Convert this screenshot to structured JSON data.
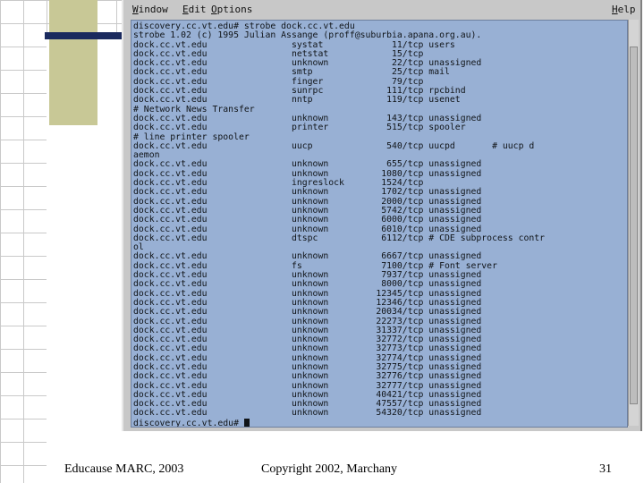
{
  "window": {
    "menu": [
      {
        "label": "Window",
        "underline": "W",
        "rest": "indow"
      },
      {
        "label": "Edit",
        "underline": "E",
        "rest": "dit"
      },
      {
        "label": "Options",
        "underline": "O",
        "rest": "ptions"
      },
      {
        "label": "Help",
        "underline": "H",
        "rest": "elp"
      }
    ]
  },
  "terminal": {
    "lines": [
      "discovery.cc.vt.edu# strobe dock.cc.vt.edu",
      "strobe 1.02 (c) 1995 Julian Assange (proff@suburbia.apana.org.au).",
      "dock.cc.vt.edu                systat             11/tcp users",
      "dock.cc.vt.edu                netstat            15/tcp",
      "dock.cc.vt.edu                unknown            22/tcp unassigned",
      "dock.cc.vt.edu                smtp               25/tcp mail",
      "dock.cc.vt.edu                finger             79/tcp",
      "dock.cc.vt.edu                sunrpc            111/tcp rpcbind",
      "dock.cc.vt.edu                nntp              119/tcp usenet",
      "# Network News Transfer",
      "dock.cc.vt.edu                unknown           143/tcp unassigned",
      "dock.cc.vt.edu                printer           515/tcp spooler",
      "# line printer spooler",
      "dock.cc.vt.edu                uucp              540/tcp uucpd       # uucp d",
      "aemon",
      "dock.cc.vt.edu                unknown           655/tcp unassigned",
      "dock.cc.vt.edu                unknown          1080/tcp unassigned",
      "dock.cc.vt.edu                ingreslock       1524/tcp",
      "dock.cc.vt.edu                unknown          1702/tcp unassigned",
      "dock.cc.vt.edu                unknown          2000/tcp unassigned",
      "dock.cc.vt.edu                unknown          5742/tcp unassigned",
      "dock.cc.vt.edu                unknown          6000/tcp unassigned",
      "dock.cc.vt.edu                unknown          6010/tcp unassigned",
      "dock.cc.vt.edu                dtspc            6112/tcp # CDE subprocess contr",
      "ol",
      "dock.cc.vt.edu                unknown          6667/tcp unassigned",
      "dock.cc.vt.edu                fs               7100/tcp # Font server",
      "dock.cc.vt.edu                unknown          7937/tcp unassigned",
      "dock.cc.vt.edu                unknown          8000/tcp unassigned",
      "dock.cc.vt.edu                unknown         12345/tcp unassigned",
      "dock.cc.vt.edu                unknown         12346/tcp unassigned",
      "dock.cc.vt.edu                unknown         20034/tcp unassigned",
      "dock.cc.vt.edu                unknown         22273/tcp unassigned",
      "dock.cc.vt.edu                unknown         31337/tcp unassigned",
      "dock.cc.vt.edu                unknown         32772/tcp unassigned",
      "dock.cc.vt.edu                unknown         32773/tcp unassigned",
      "dock.cc.vt.edu                unknown         32774/tcp unassigned",
      "dock.cc.vt.edu                unknown         32775/tcp unassigned",
      "dock.cc.vt.edu                unknown         32776/tcp unassigned",
      "dock.cc.vt.edu                unknown         32777/tcp unassigned",
      "dock.cc.vt.edu                unknown         40421/tcp unassigned",
      "dock.cc.vt.edu                unknown         47557/tcp unassigned",
      "dock.cc.vt.edu                unknown         54320/tcp unassigned",
      "discovery.cc.vt.edu# "
    ]
  },
  "footer": {
    "left": "Educause MARC, 2003",
    "center": "Copyright 2002, Marchany",
    "page": "31"
  }
}
